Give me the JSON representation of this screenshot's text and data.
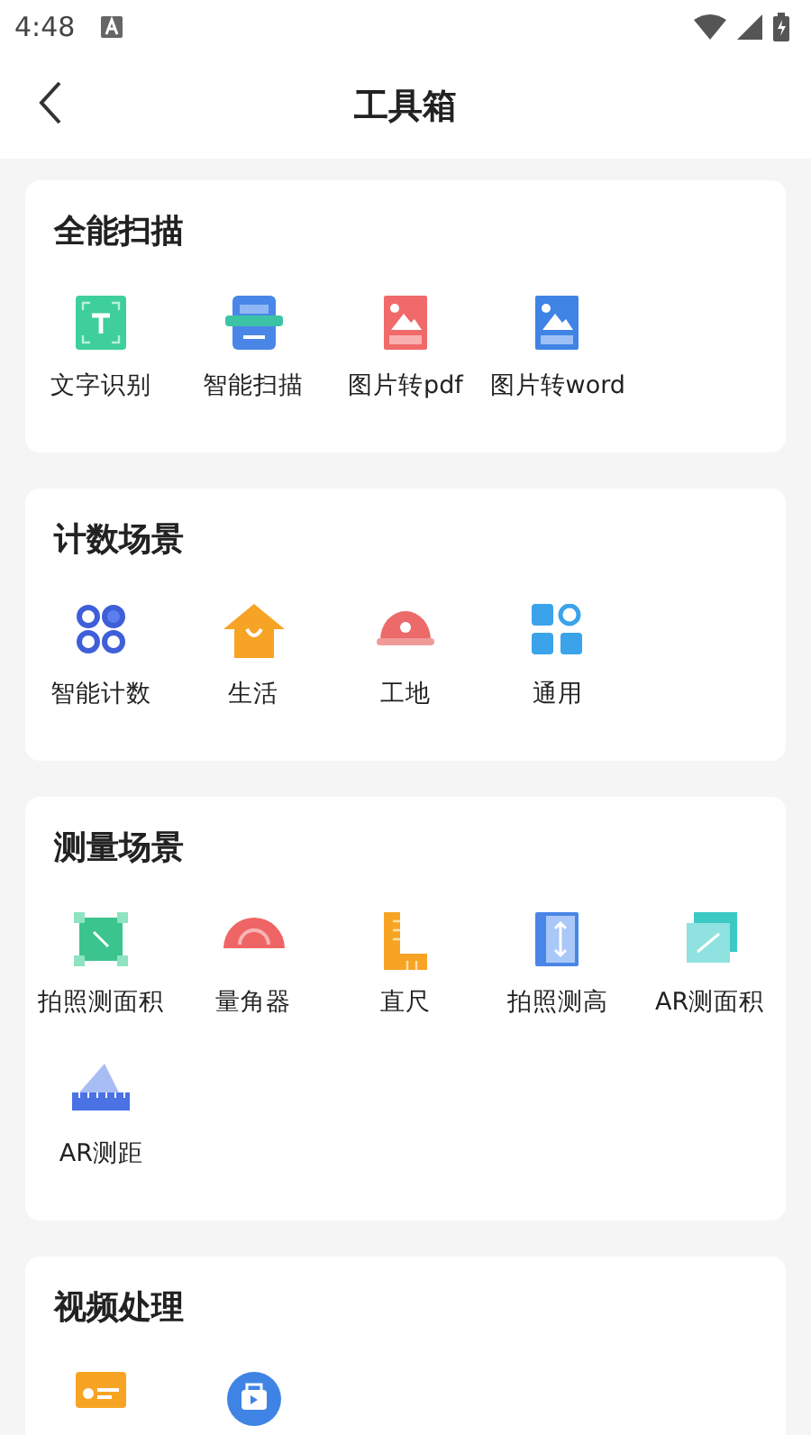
{
  "status_bar": {
    "time": "4:48"
  },
  "header": {
    "title": "工具箱"
  },
  "sections": [
    {
      "title": "全能扫描",
      "items": [
        {
          "kind": "tool",
          "label": "文字识别"
        },
        {
          "kind": "tool",
          "label": "智能扫描"
        },
        {
          "kind": "tool",
          "label": "图片转pdf"
        },
        {
          "kind": "tool",
          "label": "图片转word"
        }
      ]
    },
    {
      "title": "计数场景",
      "items": [
        {
          "kind": "tool",
          "label": "智能计数"
        },
        {
          "kind": "tool",
          "label": "生活"
        },
        {
          "kind": "tool",
          "label": "工地"
        },
        {
          "kind": "tool",
          "label": "通用"
        }
      ]
    },
    {
      "title": "测量场景",
      "items": [
        {
          "kind": "tool",
          "label": "拍照测面积"
        },
        {
          "kind": "tool",
          "label": "量角器"
        },
        {
          "kind": "tool",
          "label": "直尺"
        },
        {
          "kind": "tool",
          "label": "拍照测高"
        },
        {
          "kind": "tool",
          "label": "AR测面积"
        },
        {
          "kind": "tool",
          "label": "AR测距"
        }
      ]
    },
    {
      "title": "视频处理",
      "items": [
        {
          "kind": "icon"
        },
        {
          "kind": "icon"
        }
      ]
    }
  ]
}
